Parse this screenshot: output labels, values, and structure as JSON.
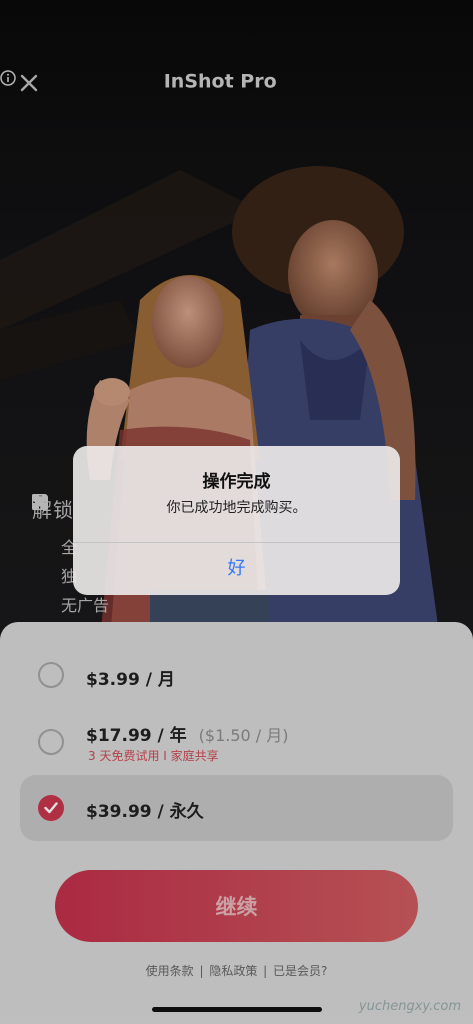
{
  "header": {
    "title": "InShot Pro",
    "close_icon": "close-icon",
    "info_icon": "info-icon"
  },
  "features": {
    "title": "解锁",
    "items": [
      {
        "icon": "grid-icon",
        "label": "全"
      },
      {
        "icon": "star-icon",
        "label": "独"
      },
      {
        "icon": "no-ads-icon",
        "label": "无广告"
      }
    ]
  },
  "plans": [
    {
      "price": "$3.99 / 月",
      "sub": "",
      "note": "",
      "selected": false
    },
    {
      "price": "$17.99 / 年",
      "sub": "($1.50 / 月)",
      "note": "3 天免费试用  I  家庭共享",
      "selected": false
    },
    {
      "price": "$39.99 / 永久",
      "sub": "",
      "note": "",
      "selected": true
    }
  ],
  "cta": {
    "label": "继续"
  },
  "footer": {
    "terms": "使用条款",
    "privacy": "隐私政策",
    "member": "已是会员?",
    "separator": "|"
  },
  "alert": {
    "title": "操作完成",
    "message": "你已成功地完成购买。",
    "ok": "好"
  },
  "watermark": "yuchengxy.com",
  "colors": {
    "accent": "#c8364d",
    "link_blue": "#3478f6",
    "sheet_bg": "#d9d9d9"
  }
}
